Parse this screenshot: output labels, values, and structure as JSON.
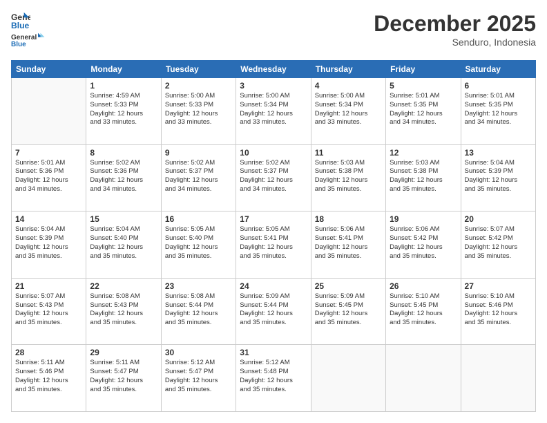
{
  "header": {
    "logo_general": "General",
    "logo_blue": "Blue",
    "month_title": "December 2025",
    "location": "Senduro, Indonesia"
  },
  "days_of_week": [
    "Sunday",
    "Monday",
    "Tuesday",
    "Wednesday",
    "Thursday",
    "Friday",
    "Saturday"
  ],
  "weeks": [
    [
      {
        "day": "",
        "info": ""
      },
      {
        "day": "1",
        "info": "Sunrise: 4:59 AM\nSunset: 5:33 PM\nDaylight: 12 hours\nand 33 minutes."
      },
      {
        "day": "2",
        "info": "Sunrise: 5:00 AM\nSunset: 5:33 PM\nDaylight: 12 hours\nand 33 minutes."
      },
      {
        "day": "3",
        "info": "Sunrise: 5:00 AM\nSunset: 5:34 PM\nDaylight: 12 hours\nand 33 minutes."
      },
      {
        "day": "4",
        "info": "Sunrise: 5:00 AM\nSunset: 5:34 PM\nDaylight: 12 hours\nand 33 minutes."
      },
      {
        "day": "5",
        "info": "Sunrise: 5:01 AM\nSunset: 5:35 PM\nDaylight: 12 hours\nand 34 minutes."
      },
      {
        "day": "6",
        "info": "Sunrise: 5:01 AM\nSunset: 5:35 PM\nDaylight: 12 hours\nand 34 minutes."
      }
    ],
    [
      {
        "day": "7",
        "info": "Sunrise: 5:01 AM\nSunset: 5:36 PM\nDaylight: 12 hours\nand 34 minutes."
      },
      {
        "day": "8",
        "info": "Sunrise: 5:02 AM\nSunset: 5:36 PM\nDaylight: 12 hours\nand 34 minutes."
      },
      {
        "day": "9",
        "info": "Sunrise: 5:02 AM\nSunset: 5:37 PM\nDaylight: 12 hours\nand 34 minutes."
      },
      {
        "day": "10",
        "info": "Sunrise: 5:02 AM\nSunset: 5:37 PM\nDaylight: 12 hours\nand 34 minutes."
      },
      {
        "day": "11",
        "info": "Sunrise: 5:03 AM\nSunset: 5:38 PM\nDaylight: 12 hours\nand 35 minutes."
      },
      {
        "day": "12",
        "info": "Sunrise: 5:03 AM\nSunset: 5:38 PM\nDaylight: 12 hours\nand 35 minutes."
      },
      {
        "day": "13",
        "info": "Sunrise: 5:04 AM\nSunset: 5:39 PM\nDaylight: 12 hours\nand 35 minutes."
      }
    ],
    [
      {
        "day": "14",
        "info": "Sunrise: 5:04 AM\nSunset: 5:39 PM\nDaylight: 12 hours\nand 35 minutes."
      },
      {
        "day": "15",
        "info": "Sunrise: 5:04 AM\nSunset: 5:40 PM\nDaylight: 12 hours\nand 35 minutes."
      },
      {
        "day": "16",
        "info": "Sunrise: 5:05 AM\nSunset: 5:40 PM\nDaylight: 12 hours\nand 35 minutes."
      },
      {
        "day": "17",
        "info": "Sunrise: 5:05 AM\nSunset: 5:41 PM\nDaylight: 12 hours\nand 35 minutes."
      },
      {
        "day": "18",
        "info": "Sunrise: 5:06 AM\nSunset: 5:41 PM\nDaylight: 12 hours\nand 35 minutes."
      },
      {
        "day": "19",
        "info": "Sunrise: 5:06 AM\nSunset: 5:42 PM\nDaylight: 12 hours\nand 35 minutes."
      },
      {
        "day": "20",
        "info": "Sunrise: 5:07 AM\nSunset: 5:42 PM\nDaylight: 12 hours\nand 35 minutes."
      }
    ],
    [
      {
        "day": "21",
        "info": "Sunrise: 5:07 AM\nSunset: 5:43 PM\nDaylight: 12 hours\nand 35 minutes."
      },
      {
        "day": "22",
        "info": "Sunrise: 5:08 AM\nSunset: 5:43 PM\nDaylight: 12 hours\nand 35 minutes."
      },
      {
        "day": "23",
        "info": "Sunrise: 5:08 AM\nSunset: 5:44 PM\nDaylight: 12 hours\nand 35 minutes."
      },
      {
        "day": "24",
        "info": "Sunrise: 5:09 AM\nSunset: 5:44 PM\nDaylight: 12 hours\nand 35 minutes."
      },
      {
        "day": "25",
        "info": "Sunrise: 5:09 AM\nSunset: 5:45 PM\nDaylight: 12 hours\nand 35 minutes."
      },
      {
        "day": "26",
        "info": "Sunrise: 5:10 AM\nSunset: 5:45 PM\nDaylight: 12 hours\nand 35 minutes."
      },
      {
        "day": "27",
        "info": "Sunrise: 5:10 AM\nSunset: 5:46 PM\nDaylight: 12 hours\nand 35 minutes."
      }
    ],
    [
      {
        "day": "28",
        "info": "Sunrise: 5:11 AM\nSunset: 5:46 PM\nDaylight: 12 hours\nand 35 minutes."
      },
      {
        "day": "29",
        "info": "Sunrise: 5:11 AM\nSunset: 5:47 PM\nDaylight: 12 hours\nand 35 minutes."
      },
      {
        "day": "30",
        "info": "Sunrise: 5:12 AM\nSunset: 5:47 PM\nDaylight: 12 hours\nand 35 minutes."
      },
      {
        "day": "31",
        "info": "Sunrise: 5:12 AM\nSunset: 5:48 PM\nDaylight: 12 hours\nand 35 minutes."
      },
      {
        "day": "",
        "info": ""
      },
      {
        "day": "",
        "info": ""
      },
      {
        "day": "",
        "info": ""
      }
    ]
  ]
}
